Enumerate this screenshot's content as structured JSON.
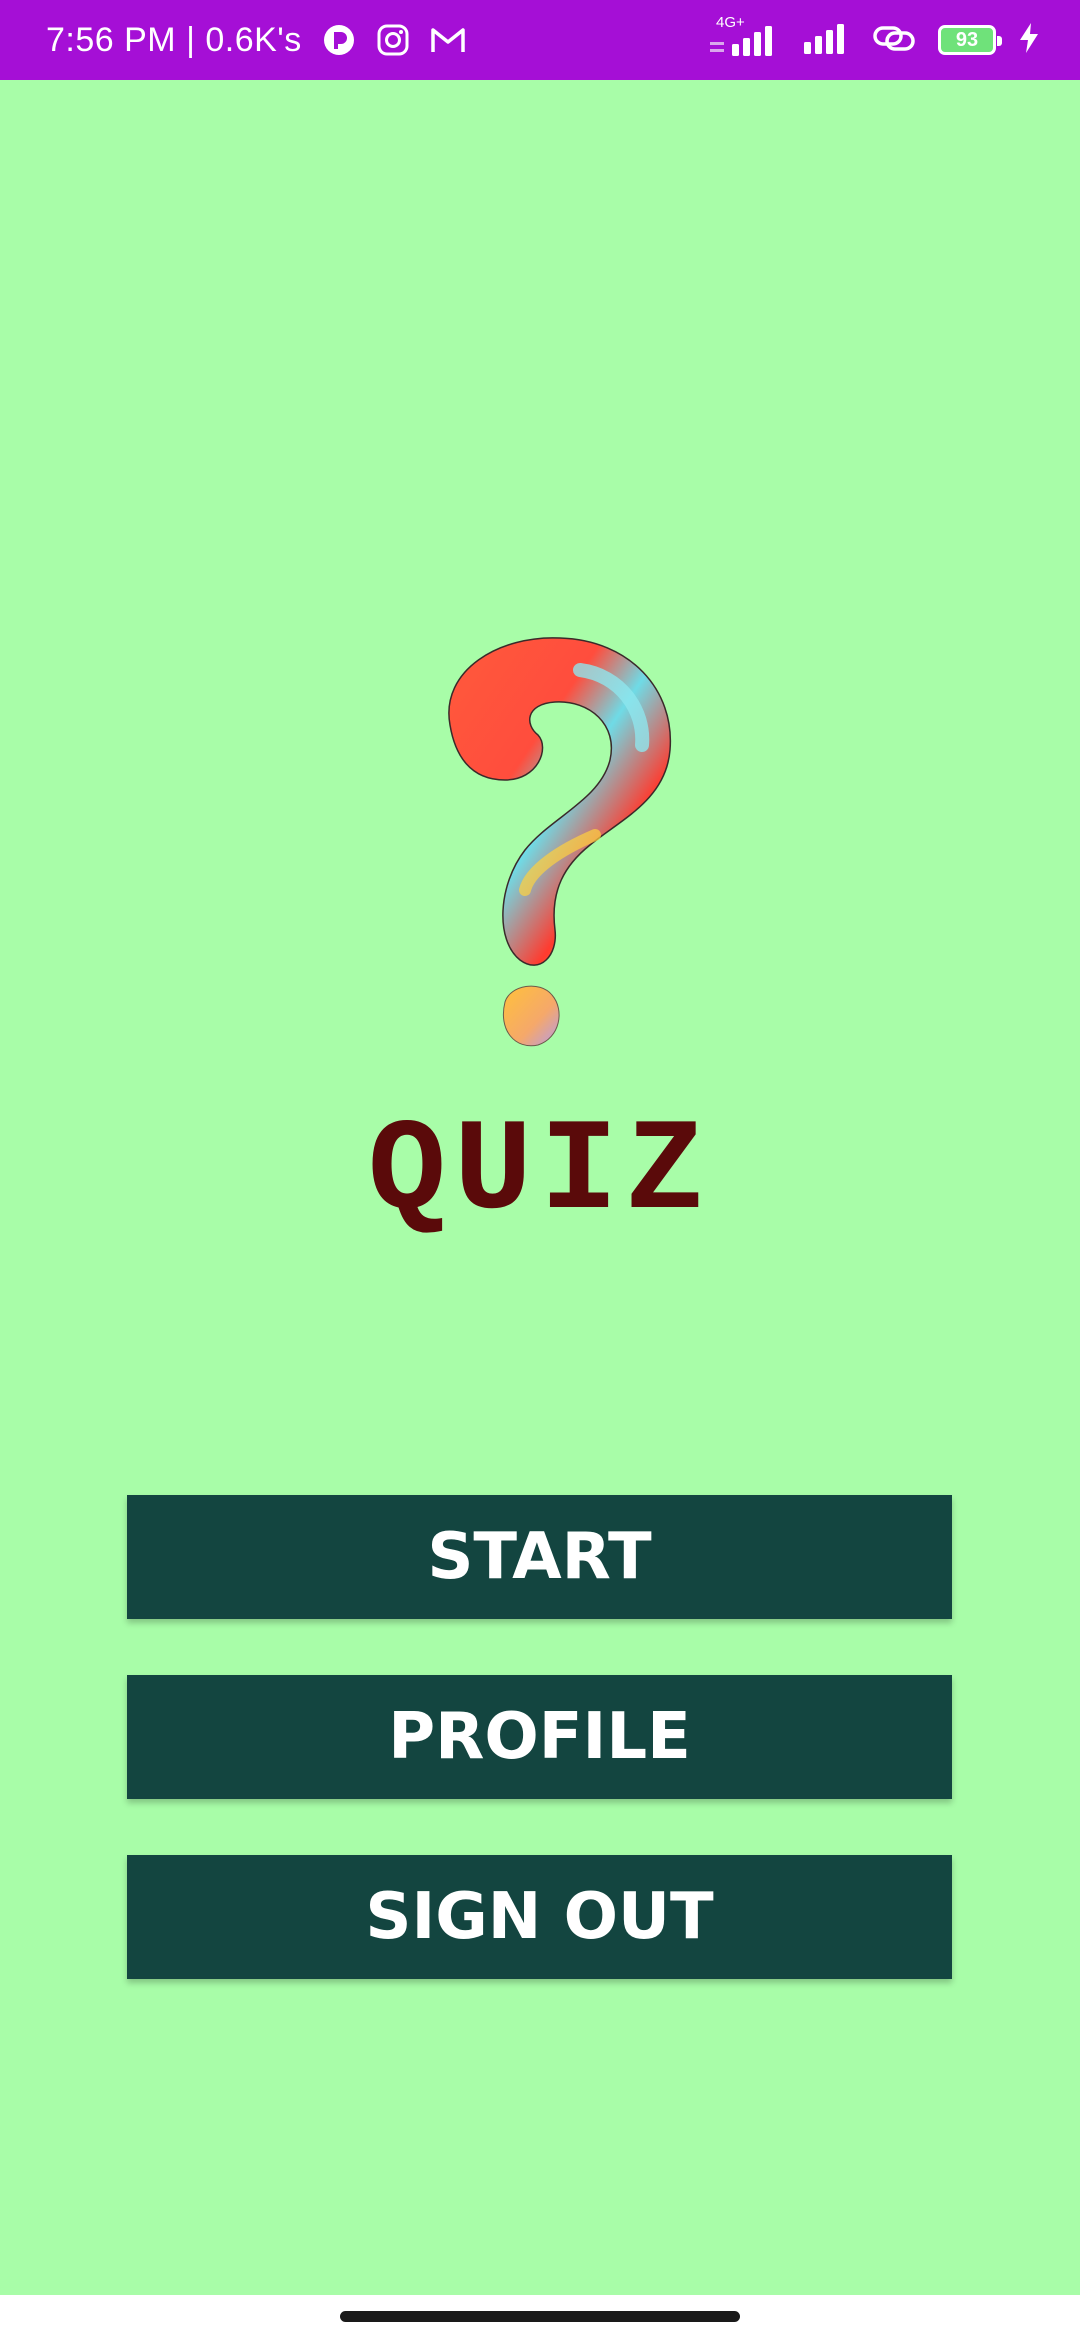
{
  "status_bar": {
    "time_speed": "7:56 PM | 0.6K's",
    "network_type": "4G+",
    "battery_level": "93",
    "icons": [
      "app-icon",
      "instagram-icon",
      "gmail-icon",
      "signal-4g-icon",
      "signal-icon",
      "link-icon",
      "battery-icon",
      "charging-icon"
    ],
    "background_color": "#a50fd6"
  },
  "main": {
    "background_color": "#a8fda8",
    "logo_icon": "question-mark-icon",
    "title": "QUIZ",
    "title_color": "#5a0a0a",
    "buttons": [
      {
        "label": "START"
      },
      {
        "label": "PROFILE"
      },
      {
        "label": "SIGN OUT"
      }
    ],
    "button_color": "#134540"
  }
}
